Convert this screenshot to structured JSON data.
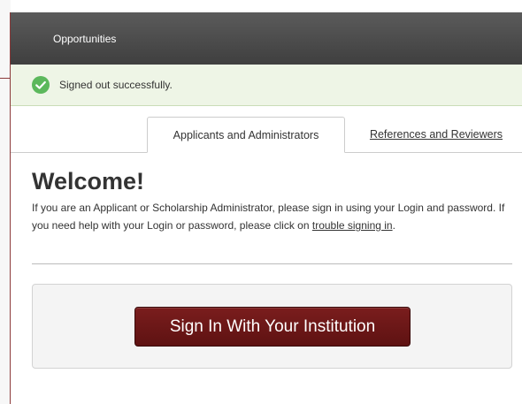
{
  "navbar": {
    "link_label": "Opportunities"
  },
  "alert": {
    "message": "Signed out successfully.",
    "icon": "check-circle-icon",
    "color": "#5cb85c"
  },
  "tabs": [
    {
      "label": "Applicants and Administrators",
      "active": true
    },
    {
      "label": "References and Reviewers",
      "active": false
    }
  ],
  "welcome": {
    "heading": "Welcome!",
    "intro_text": "If you are an Applicant or Scholarship Administrator, please sign in using your Login and password. If you need help with your Login or password, please click on ",
    "help_link": "trouble signing in",
    "intro_end": "."
  },
  "signin": {
    "button_label": "Sign In With Your Institution",
    "button_color": "#6b1818"
  }
}
